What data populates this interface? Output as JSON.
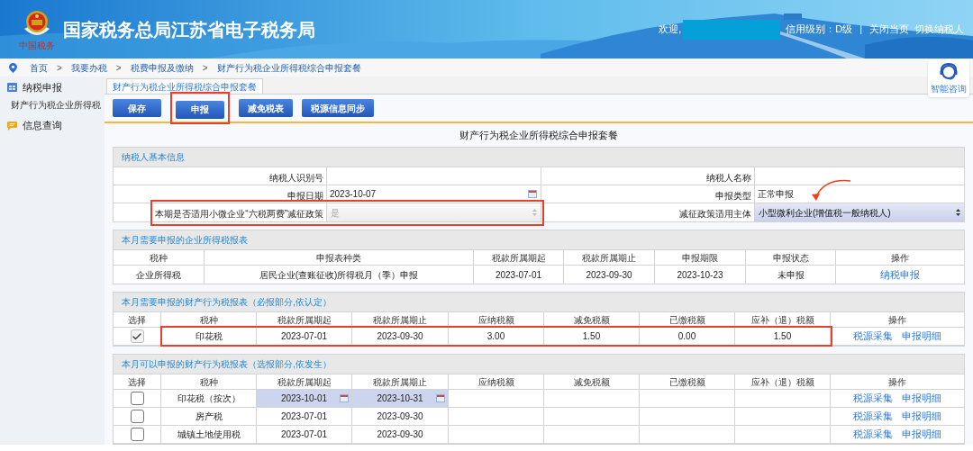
{
  "header": {
    "logo_caption": "中国税务",
    "title": "国家税务总局江苏省电子税务局",
    "welcome": "欢迎,",
    "credit": "信用级别：D级",
    "separator": "|",
    "links": [
      "关闭当页",
      "切换纳税人"
    ]
  },
  "breadcrumb": {
    "separator": ">",
    "items": [
      "首页",
      "我要办税",
      "税费申报及缴纳",
      "财产行为税企业所得税综合申报套餐"
    ]
  },
  "sidebar": {
    "items": [
      {
        "label": "纳税申报",
        "kind": "declare",
        "children": [
          {
            "label": "财产行为税企业所得税"
          }
        ]
      },
      {
        "label": "信息查询",
        "kind": "query"
      }
    ]
  },
  "assistant": {
    "label": "智能咨询"
  },
  "tabs": [
    {
      "label": "财产行为税企业所得税综合申报套餐",
      "selected": true
    }
  ],
  "toolbar": [
    {
      "label": "保存"
    },
    {
      "label": "申报",
      "annotated": true
    },
    {
      "label": "减免税表"
    },
    {
      "label": "税源信息同步"
    }
  ],
  "page_title": "财产行为税企业所得税综合申报套餐",
  "taxpayer_info": {
    "title": "纳税人基本信息",
    "rows": [
      [
        {
          "label": "纳税人识别号",
          "kind": "text"
        },
        {
          "label": "纳税人名称",
          "kind": "text"
        }
      ],
      [
        {
          "label": "申报日期",
          "kind": "date",
          "value": "2023-10-07"
        },
        {
          "label": "申报类型",
          "kind": "text",
          "value": "正常申报"
        }
      ],
      [
        {
          "label": "本期是否适用小微企业“六税两费”减征政策",
          "kind": "select",
          "value": "是",
          "disabled": true,
          "annotated": true
        },
        {
          "label": "减征政策适用主体",
          "kind": "select",
          "value": "小型微利企业(增值税一般纳税人)",
          "disabled": false,
          "pointed": true
        }
      ]
    ]
  },
  "income_tax": {
    "title": "本月需要申报的企业所得税报表",
    "columns": [
      "税种",
      "申报表种类",
      "税款所属期起",
      "税款所属期止",
      "申报期限",
      "申报状态",
      "操作"
    ],
    "rows": [
      {
        "cells": [
          "企业所得税",
          "居民企业(查账征收)所得税月（季）申报",
          "2023-07-01",
          "2023-09-30",
          "2023-10-23",
          "未申报"
        ],
        "actions": [
          "纳税申报"
        ]
      }
    ]
  },
  "required_taxes": {
    "title": "本月需要申报的财产行为税报表（必报部分,依认定）",
    "columns": [
      "选择",
      "税种",
      "税款所属期起",
      "税款所属期止",
      "应纳税额",
      "减免税额",
      "已缴税额",
      "应补（退）税额",
      "操作"
    ],
    "rows": [
      {
        "checked": true,
        "annotated": true,
        "tax": "印花税",
        "start": "2023-07-01",
        "end": "2023-09-30",
        "payable": "3.00",
        "relief": "1.50",
        "paid": "0.00",
        "due": "1.50",
        "actions": [
          "税源采集",
          "申报明细"
        ]
      }
    ]
  },
  "optional_taxes": {
    "title": "本月可以申报的财产行为税报表（选报部分,依发生）",
    "columns": [
      "选择",
      "税种",
      "税款所属期起",
      "税款所属期止",
      "应纳税额",
      "减免税额",
      "已缴税额",
      "应补（退）税额",
      "操作"
    ],
    "rows": [
      {
        "checked": false,
        "dates_editable": true,
        "tax": "印花税（按次）",
        "start": "2023-10-01",
        "end": "2023-10-31",
        "actions": [
          "税源采集",
          "申报明细"
        ]
      },
      {
        "checked": false,
        "tax": "房产税",
        "start": "2023-07-01",
        "end": "2023-09-30",
        "actions": [
          "税源采集",
          "申报明细"
        ]
      },
      {
        "checked": false,
        "tax": "城镇土地使用税",
        "start": "2023-07-01",
        "end": "2023-09-30",
        "actions": [
          "税源采集",
          "申报明细"
        ]
      }
    ]
  }
}
